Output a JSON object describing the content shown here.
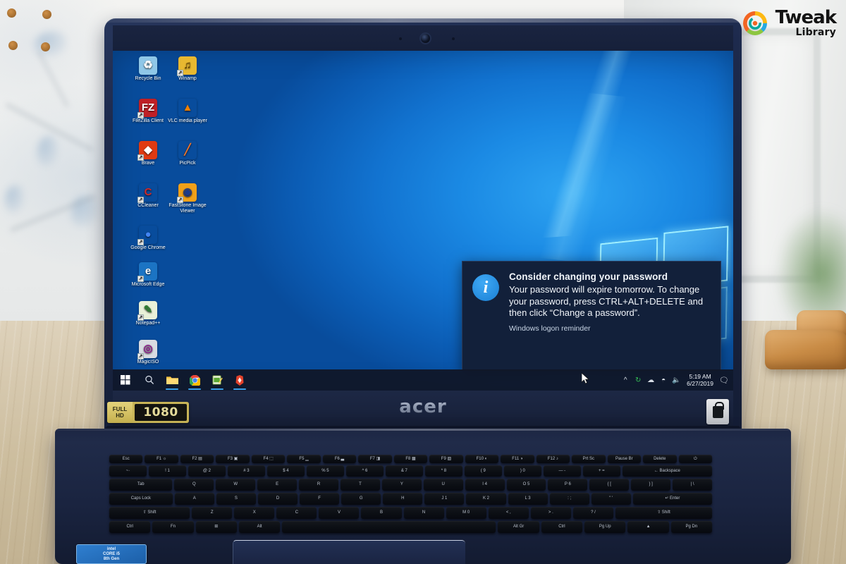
{
  "watermark": {
    "name": "tweak-library-logo",
    "line1": "Tweak",
    "line2": "Library",
    "mark_colors": [
      "#f26522",
      "#8dc63f",
      "#27aae1",
      "#fdb913",
      "#00a79d"
    ]
  },
  "device": {
    "brand_logo": "acer",
    "hd_badge": {
      "line1": "FULL",
      "line2": "HD",
      "resolution": "1080"
    },
    "fingerprint_badge": "lock-icon",
    "cpu_sticker": {
      "line1": "intel",
      "line2": "CORE i5",
      "line3": "8th Gen"
    },
    "webcam": "webcam-icon"
  },
  "desktop": {
    "wallpaper": "windows-10-hero",
    "icons": [
      {
        "label": "Recycle Bin",
        "glyph": "♻",
        "bg": "#8fc7e8",
        "fg": "#ffffff",
        "shortcut": false,
        "col": 0,
        "row": 0
      },
      {
        "label": "Winamp",
        "glyph": "♫",
        "bg": "#e8b830",
        "fg": "#5a3b00",
        "shortcut": true,
        "col": 1,
        "row": 0
      },
      {
        "label": "FileZilla Client",
        "glyph": "FZ",
        "bg": "#bf2026",
        "fg": "#ffffff",
        "shortcut": true,
        "col": 0,
        "row": 1
      },
      {
        "label": "VLC media player",
        "glyph": "▲",
        "bg": "transparent",
        "fg": "#f08000",
        "shortcut": false,
        "col": 1,
        "row": 1
      },
      {
        "label": "Brave",
        "glyph": "◆",
        "bg": "#e03a12",
        "fg": "#ffffff",
        "shortcut": true,
        "col": 0,
        "row": 2
      },
      {
        "label": "PicPick",
        "glyph": "╱",
        "bg": "transparent",
        "fg": "#f2762a",
        "shortcut": false,
        "col": 1,
        "row": 2
      },
      {
        "label": "CCleaner",
        "glyph": "C",
        "bg": "transparent",
        "fg": "#d02a2a",
        "shortcut": true,
        "col": 0,
        "row": 3
      },
      {
        "label": "FastStone Image Viewer",
        "glyph": "◉",
        "bg": "#f0a019",
        "fg": "#1b3a8c",
        "shortcut": true,
        "col": 1,
        "row": 3
      },
      {
        "label": "Google Chrome",
        "glyph": "●",
        "bg": "transparent",
        "fg": "#4285f4",
        "shortcut": true,
        "col": 0,
        "row": 4
      },
      {
        "label": "Microsoft Edge",
        "glyph": "e",
        "bg": "#1b74c4",
        "fg": "#ffffff",
        "shortcut": true,
        "col": 0,
        "row": 5
      },
      {
        "label": "Notepad++",
        "glyph": "✎",
        "bg": "#e8f0d8",
        "fg": "#2e7d32",
        "shortcut": true,
        "col": 0,
        "row": 6
      },
      {
        "label": "MagicISO",
        "glyph": "◎",
        "bg": "#d8dbe2",
        "fg": "#8b1a8b",
        "shortcut": true,
        "col": 0,
        "row": 7
      }
    ]
  },
  "notification": {
    "icon": "info-icon",
    "title": "Consider changing your password",
    "message": "Your password will expire tomorrow. To change your password, press CTRL+ALT+DELETE and then click “Change a password”.",
    "source": "Windows logon reminder"
  },
  "taskbar": {
    "buttons": [
      {
        "name": "start-button",
        "glyph": "windows"
      },
      {
        "name": "search-button",
        "glyph": "search"
      },
      {
        "name": "file-explorer-button",
        "glyph": "folder",
        "running": true
      },
      {
        "name": "google-chrome-button",
        "glyph": "chrome",
        "running": true
      },
      {
        "name": "notepad-plus-plus-button",
        "glyph": "notepad",
        "running": true
      },
      {
        "name": "brave-button",
        "glyph": "brave",
        "running": true
      }
    ],
    "tray": [
      {
        "name": "show-hidden-icons-button",
        "glyph": "˄"
      },
      {
        "name": "sync-icon",
        "glyph": "↻"
      },
      {
        "name": "onedrive-icon",
        "glyph": "☁"
      },
      {
        "name": "network-icon",
        "glyph": "◠"
      },
      {
        "name": "volume-icon",
        "glyph": "◁"
      }
    ],
    "clock": {
      "time": "5:19 AM",
      "date": "6/27/2019"
    },
    "action_center": "▭",
    "cursor": "pointer-arrow"
  },
  "keyboard": {
    "row_fn": [
      "Esc",
      "F1 ☼",
      "F2 ▤",
      "F3 ▣",
      "F4 ⬚",
      "F5 ▁",
      "F6 ▃",
      "F7 ◨",
      "F8 ▩",
      "F9 ▧",
      "F10 ◐",
      "F11 ◑",
      "F12 ♪",
      "Prt Sc",
      "Pause Br",
      "Delete",
      "⏻"
    ],
    "row_num": [
      "~·",
      "! 1",
      "@ 2",
      "# 3",
      "$ 4",
      "% 5",
      "^ 6",
      "& 7",
      "* 8",
      "( 9",
      ") 0",
      "— -",
      "+ =",
      "← Backspace"
    ],
    "row_q": [
      "Tab",
      "Q",
      "W",
      "E",
      "R",
      "T",
      "Y",
      "U",
      "I 4",
      "O 5",
      "P 6",
      "{ [",
      "} ]",
      "| \\"
    ],
    "row_a": [
      "Caps Lock",
      "A",
      "S",
      "D",
      "F",
      "G",
      "H",
      "J 1",
      "K 2",
      "L 3",
      ": ;",
      "\" '",
      "↵ Enter"
    ],
    "row_z": [
      "⇧ Shift",
      "Z",
      "X",
      "C",
      "V",
      "B",
      "N",
      "M 0",
      "< ,",
      "> .",
      "? /",
      "⇧ Shift"
    ],
    "row_ctl": [
      "Ctrl",
      "Fn",
      "⊞",
      "Alt",
      "",
      "Alt Gr",
      "Ctrl",
      "Pg Up",
      "▲",
      "Pg Dn"
    ]
  }
}
